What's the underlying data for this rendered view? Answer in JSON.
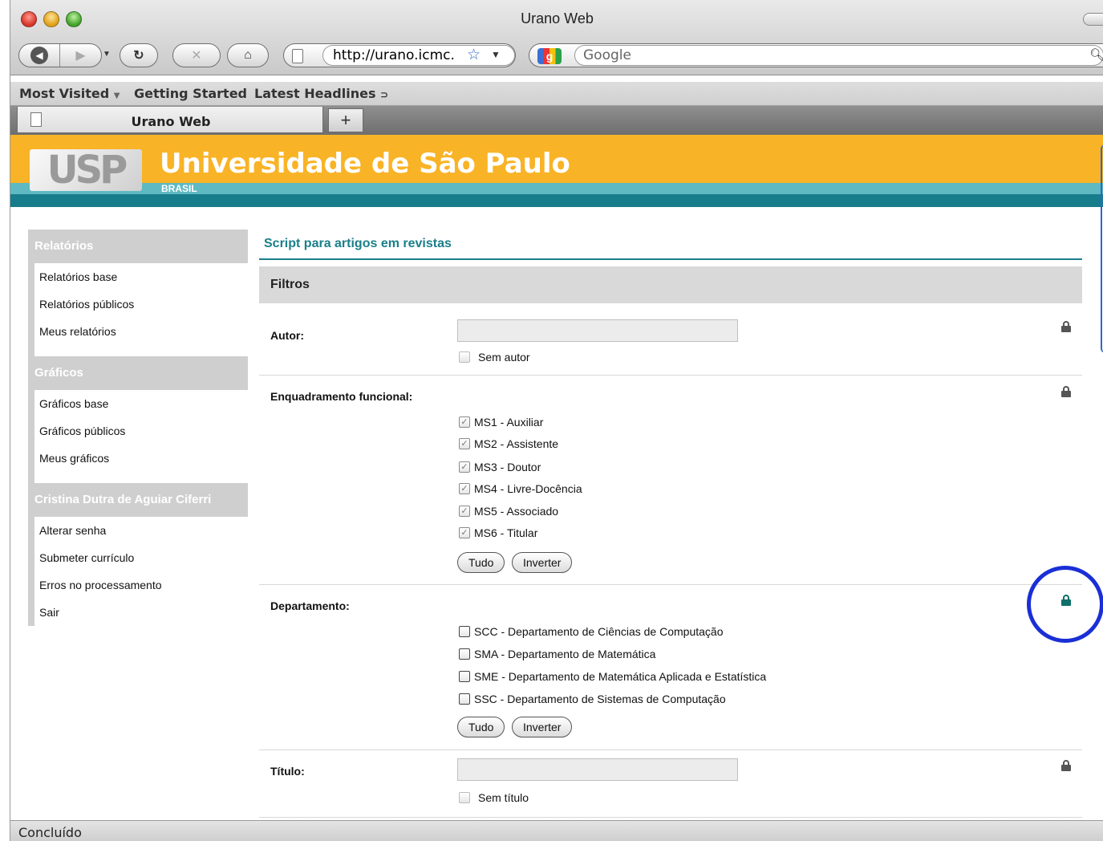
{
  "browser": {
    "window_title": "Urano Web",
    "url": "http://urano.icmc.",
    "search_placeholder": "Google",
    "search_engine_glyph": "g",
    "bookmarks": [
      "Most Visited",
      "Getting Started",
      "Latest Headlines"
    ],
    "tab_title": "Urano Web",
    "new_tab_label": "+",
    "status": "Concluído"
  },
  "header": {
    "logo_text": "USP",
    "title": "Universidade de São Paulo",
    "subtitle": "BRASIL",
    "colors": {
      "orange": "#f9b326",
      "teal_light": "#5fb9c2",
      "teal_dark": "#187d8a"
    }
  },
  "sidebar": {
    "groups": [
      {
        "title": "Relatórios",
        "items": [
          "Relatórios base",
          "Relatórios públicos",
          "Meus relatórios"
        ]
      },
      {
        "title": "Gráficos",
        "items": [
          "Gráficos base",
          "Gráficos públicos",
          "Meus gráficos"
        ]
      },
      {
        "title": "Cristina Dutra de Aguiar Ciferri",
        "items": [
          "Alterar senha",
          "Submeter currículo",
          "Erros no processamento",
          "Sair"
        ]
      }
    ]
  },
  "main": {
    "title": "Script para artigos em revistas",
    "filters_title": "Filtros",
    "autor": {
      "label": "Autor:",
      "value": "",
      "checkbox": "Sem autor"
    },
    "enquadramento": {
      "label": "Enquadramento funcional:",
      "options": [
        "MS1 - Auxiliar",
        "MS2 - Assistente",
        "MS3 - Doutor",
        "MS4 - Livre-Docência",
        "MS5 - Associado",
        "MS6 - Titular"
      ],
      "all_button": "Tudo",
      "invert_button": "Inverter"
    },
    "departamento": {
      "label": "Departamento:",
      "options": [
        "SCC - Departamento de Ciências de Computação",
        "SMA - Departamento de Matemática",
        "SME - Departamento de Matemática Aplicada e Estatística",
        "SSC - Departamento de Sistemas de Computação"
      ],
      "all_button": "Tudo",
      "invert_button": "Inverter"
    },
    "titulo": {
      "label": "Título:",
      "value": "",
      "checkbox": "Sem título"
    },
    "colors": {
      "accent": "#1a7f8a",
      "unlocked_lock": "#0f6f6a",
      "highlight": "#1a2fd6"
    }
  }
}
